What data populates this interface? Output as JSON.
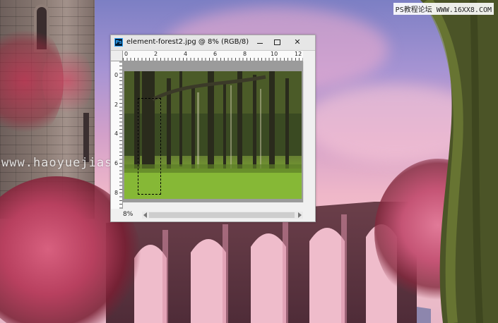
{
  "document_window": {
    "app_icon": "photoshop-icon",
    "app_icon_text": "Ps",
    "title": "element-forest2.jpg @ 8% (RGB/8)",
    "controls": {
      "minimize": "minimize-icon",
      "maximize": "maximize-icon",
      "close": "✕"
    },
    "ruler_horizontal": [
      "0",
      "2",
      "4",
      "6",
      "8",
      "10",
      "12"
    ],
    "ruler_vertical": [
      "0",
      "2",
      "4",
      "6",
      "8"
    ],
    "zoom_level": "8%",
    "selection_tool": "rectangular-marquee"
  },
  "watermarks": {
    "site_url": "www.haoyuejiasheji.com",
    "corner_logo": "PS教程论坛 WWW.16XX8.COM"
  },
  "colors": {
    "sky_top": "#7c7fc4",
    "sky_pink": "#efb7c9",
    "ps_window_bg": "#f0f0f0",
    "ps_icon_blue": "#31a8ff"
  }
}
